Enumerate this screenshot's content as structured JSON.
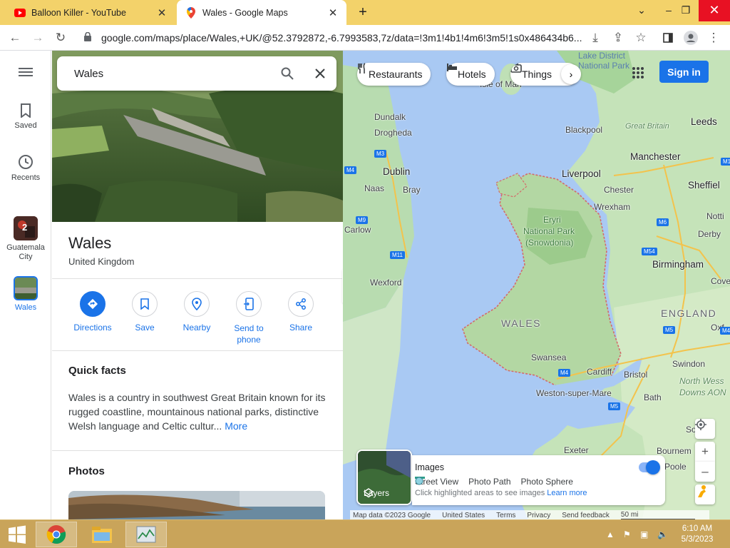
{
  "browser": {
    "tabs": [
      {
        "title": "Balloon Killer - YouTube",
        "icon": "youtube-icon"
      },
      {
        "title": "Wales - Google Maps",
        "icon": "google-maps-icon"
      }
    ],
    "url": "google.com/maps/place/Wales,+UK/@52.3792872,-6.7993583,7z/data=!3m1!4b1!4m6!3m5!1s0x486434b6..."
  },
  "rail": {
    "saved": "Saved",
    "recents": "Recents",
    "recent_places": [
      {
        "label": "Guatemala City",
        "badge": "2"
      },
      {
        "label": "Wales"
      }
    ]
  },
  "search": {
    "query": "Wales"
  },
  "place": {
    "title": "Wales",
    "subtitle": "United Kingdom",
    "actions": [
      {
        "label": "Directions"
      },
      {
        "label": "Save"
      },
      {
        "label": "Nearby"
      },
      {
        "label": "Send to phone"
      },
      {
        "label": "Share"
      }
    ],
    "quick_facts_heading": "Quick facts",
    "quick_facts_text": "Wales is a country in southwest Great Britain known for its rugged coastline, mountainous national parks, distinctive Welsh language and Celtic cultur...",
    "more_link": "More",
    "photos_heading": "Photos"
  },
  "map": {
    "chips": [
      "Restaurants",
      "Hotels",
      "Things"
    ],
    "signin": "Sign in",
    "layers_label": "Layers",
    "images_title": "Images",
    "legend": [
      "Street View",
      "Photo Path",
      "Photo Sphere"
    ],
    "hint": "Click highlighted areas to see images",
    "learn_more": "Learn more",
    "footer": [
      "Map data ©2023 Google",
      "United States",
      "Terms",
      "Privacy",
      "Send feedback",
      "50 mi"
    ],
    "places": {
      "lake_district": "Lake District",
      "national_park_ld": "National Park",
      "isle_of_man": "Isle of Man",
      "dundalk": "Dundalk",
      "drogheda": "Drogheda",
      "dublin": "Dublin",
      "naas": "Naas",
      "bray": "Bray",
      "carlow": "Carlow",
      "wexford": "Wexford",
      "blackpool": "Blackpool",
      "greater_britain": "Great Britain",
      "leeds": "Leeds",
      "manchester": "Manchester",
      "liverpool": "Liverpool",
      "chester": "Chester",
      "sheffield": "Sheffiel",
      "wrexham": "Wrexham",
      "eryri": "Eryri",
      "national_park": "National Park",
      "snowdonia": "(Snowdonia)",
      "nottingham": "Notti",
      "derby": "Derby",
      "birmingham": "Birmingham",
      "coventry": "Cove",
      "wales": "WALES",
      "england": "ENGLAND",
      "swansea": "Swansea",
      "cardiff": "Cardiff",
      "bristol": "Bristol",
      "oxford": "Oxf",
      "swindon": "Swindon",
      "north_wessex": "North Wess",
      "downs_aonb": "Downs AON",
      "weston": "Weston-super-Mare",
      "bath": "Bath",
      "exeter": "Exeter",
      "bournemouth": "Bournem",
      "poole": "Poole",
      "southampton": "So"
    },
    "roads": [
      "M3",
      "M4",
      "M9",
      "M11",
      "M1",
      "M6",
      "M54",
      "M5",
      "M4",
      "M5",
      "M4"
    ]
  },
  "taskbar": {
    "time": "6:10 AM",
    "date": "5/3/2023"
  }
}
